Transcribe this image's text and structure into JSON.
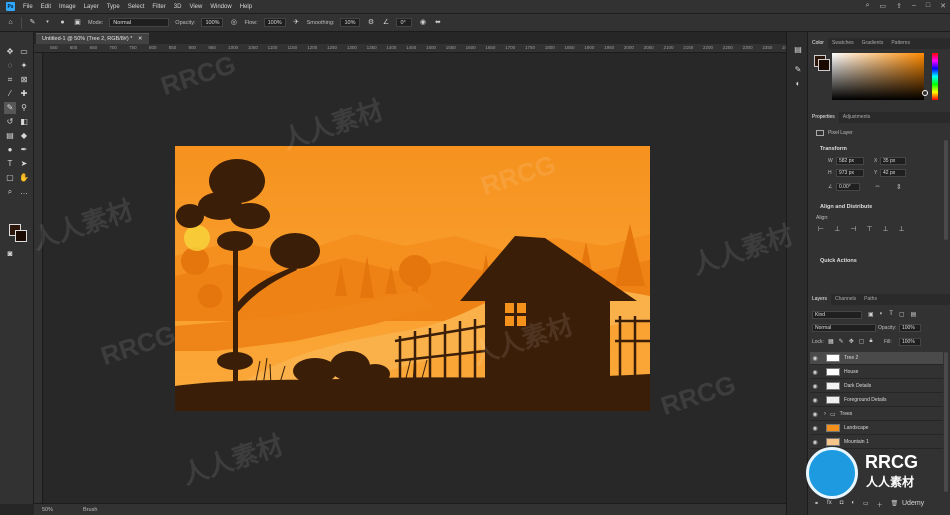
{
  "app": {
    "menu": [
      "File",
      "Edit",
      "Image",
      "Layer",
      "Type",
      "Select",
      "Filter",
      "3D",
      "View",
      "Window",
      "Help"
    ]
  },
  "options": {
    "mode_label": "Mode:",
    "mode_value": "Normal",
    "opacity_label": "Opacity:",
    "opacity_value": "100%",
    "flow_label": "Flow:",
    "flow_value": "100%",
    "smoothing_label": "Smoothing:",
    "smoothing_value": "10%",
    "angle_value": "0°"
  },
  "document": {
    "tab_title": "Untitled-1 @ 50% (Tree 2, RGB/8#) *",
    "zoom": "50%",
    "status_tool": "Brush"
  },
  "ruler": {
    "ticks": [
      "550",
      "600",
      "650",
      "700",
      "750",
      "800",
      "850",
      "900",
      "950",
      "1000",
      "1050",
      "1100",
      "1150",
      "1200",
      "1250",
      "1300",
      "1350",
      "1400",
      "1450",
      "1500",
      "1550",
      "1600",
      "1650",
      "1700",
      "1750",
      "1800",
      "1850",
      "1900",
      "1950",
      "2000",
      "2050",
      "2100",
      "2150",
      "2200",
      "2250",
      "2300",
      "2350",
      "242"
    ]
  },
  "color_panel": {
    "tabs": [
      "Color",
      "Swatches",
      "Gradients",
      "Patterns"
    ],
    "hue_color": "#ff8a00"
  },
  "properties": {
    "tabs": [
      "Properties",
      "Adjustments"
    ],
    "layer_type": "Pixel Layer",
    "transform_title": "Transform",
    "w_label": "W",
    "w_value": "582 px",
    "h_label": "H",
    "h_value": "973 px",
    "x_label": "X",
    "x_value": "35 px",
    "y_label": "Y",
    "y_value": "42 px",
    "angle_value": "0.00°",
    "align_title": "Align and Distribute",
    "align_label": "Align:",
    "quick_actions_title": "Quick Actions"
  },
  "layers_panel": {
    "tabs": [
      "Layers",
      "Channels",
      "Paths"
    ],
    "kind_label": "Kind",
    "blend_mode": "Normal",
    "opacity_label": "Opacity:",
    "opacity_value": "100%",
    "lock_label": "Lock:",
    "fill_label": "Fill:",
    "fill_value": "100%",
    "layers": [
      {
        "name": "Tree 2",
        "selected": true,
        "thumb": "#ffffff"
      },
      {
        "name": "House",
        "selected": false,
        "thumb": "#ffffff"
      },
      {
        "name": "Dark Details",
        "selected": false,
        "thumb": "#f3f3f3"
      },
      {
        "name": "Foreground Details",
        "selected": false,
        "thumb": "#f0f0f0"
      },
      {
        "name": "Trees",
        "selected": false,
        "thumb": "folder"
      },
      {
        "name": "Landscape",
        "selected": false,
        "thumb": "#f2901a"
      },
      {
        "name": "Mountain 1",
        "selected": false,
        "thumb": "#f6c58a"
      }
    ]
  },
  "watermark": {
    "brand_text": "RRCG",
    "brand_sub": "人人素材",
    "udemy": "Udemy"
  }
}
